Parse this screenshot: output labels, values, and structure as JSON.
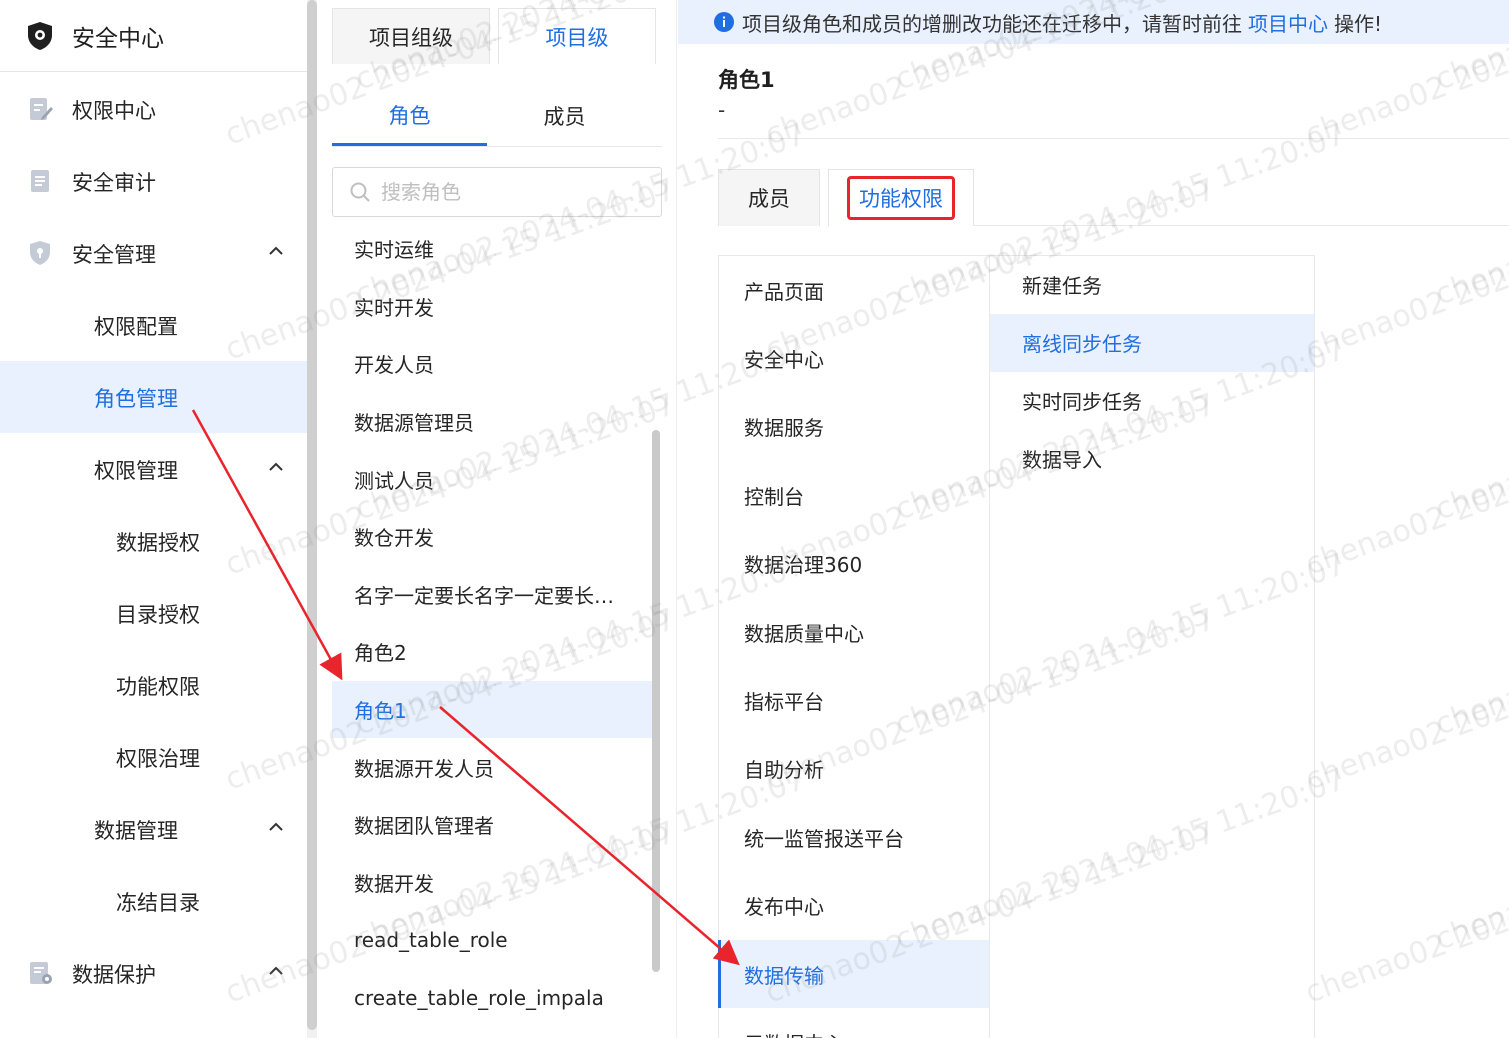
{
  "sidebar": {
    "title": "安全中心",
    "items": [
      {
        "label": "权限中心",
        "icon": "edit-doc-icon"
      },
      {
        "label": "安全审计",
        "icon": "document-icon"
      },
      {
        "label": "安全管理",
        "icon": "shield-icon"
      },
      {
        "label": "权限配置"
      },
      {
        "label": "角色管理"
      },
      {
        "label": "权限管理"
      },
      {
        "label": "数据授权"
      },
      {
        "label": "目录授权"
      },
      {
        "label": "功能权限"
      },
      {
        "label": "权限治理"
      },
      {
        "label": "数据管理"
      },
      {
        "label": "冻结目录"
      },
      {
        "label": "数据保护",
        "icon": "data-protect-icon"
      }
    ]
  },
  "role_panel": {
    "level_tabs": [
      "项目组级",
      "项目级"
    ],
    "sub_tabs": [
      "角色",
      "成员"
    ],
    "search_placeholder": "搜索角色",
    "roles": [
      "实时运维",
      "实时开发",
      "开发人员",
      "数据源管理员",
      "测试人员",
      "数仓开发",
      "名字一定要长名字一定要长名字一定要长",
      "角色2",
      "角色1",
      "数据源开发人员",
      "数据团队管理者",
      "数据开发",
      "read_table_role",
      "create_table_role_impala"
    ],
    "selected_role": "角色1"
  },
  "detail": {
    "notice": {
      "before": "项目级角色和成员的增删改功能还在迁移中，请暂时前往",
      "link": "项目中心",
      "after": "操作!"
    },
    "role_name": "角色1",
    "role_desc": "-",
    "tabs": [
      "成员",
      "功能权限"
    ],
    "active_tab": "功能权限",
    "modules": [
      "产品页面",
      "安全中心",
      "数据服务",
      "控制台",
      "数据治理360",
      "数据质量中心",
      "指标平台",
      "自助分析",
      "统一监管报送平台",
      "发布中心",
      "数据传输",
      "元数据中心"
    ],
    "active_module": "数据传输",
    "functions": [
      "新建任务",
      "离线同步任务",
      "实时同步任务",
      "数据导入"
    ],
    "active_function": "离线同步任务"
  },
  "watermark": "chenao02 2024-04-15 11:20:07",
  "colors": {
    "accent": "#1f6fe0",
    "active_bg": "#e8f1fd",
    "highlight_box": "#e8242c",
    "arrow": "#e8242c"
  }
}
